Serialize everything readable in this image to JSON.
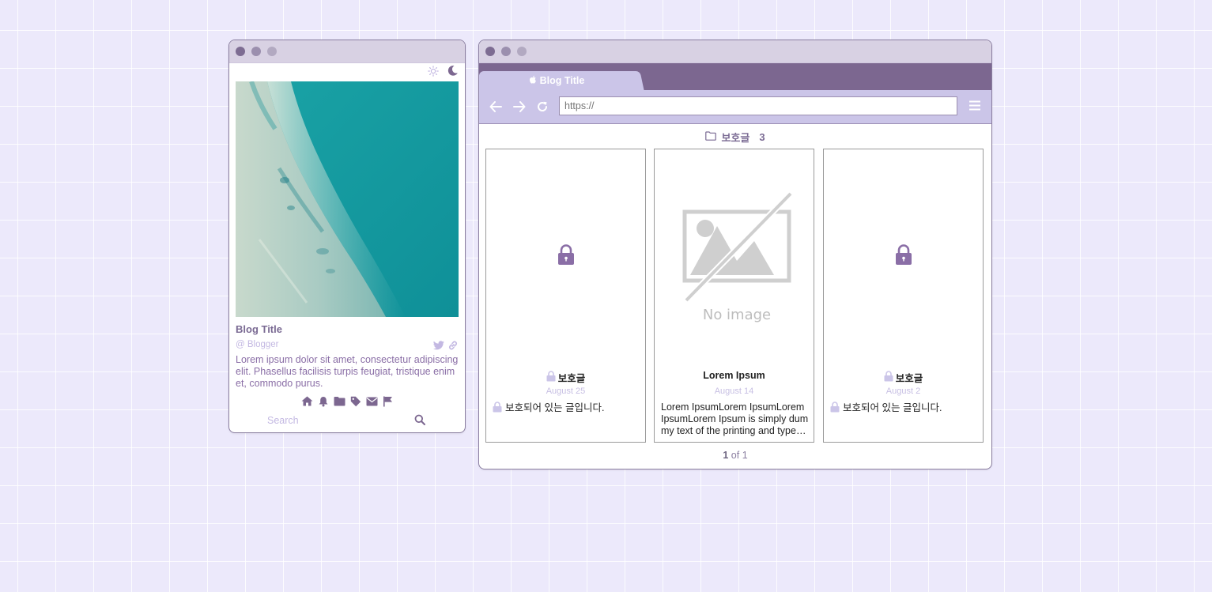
{
  "left_window": {
    "theme": {
      "light_icon": "sun-icon",
      "dark_icon": "moon-icon"
    },
    "hero_image": "ocean-shore-photo",
    "blog_title": "Blog Title",
    "handle": "@ Blogger",
    "social_icons": [
      "twitter-icon",
      "link-icon"
    ],
    "description": "Lorem ipsum dolor sit amet, consectetur adipiscing elit. Phasellus facilisis turpis feugiat, tristique enim et, commodo purus.",
    "nav_icons": [
      "home-icon",
      "bell-icon",
      "folder-icon",
      "tag-icon",
      "mail-icon",
      "flag-icon"
    ],
    "search": {
      "placeholder": "Search",
      "value": ""
    }
  },
  "browser": {
    "tab": {
      "icon": "apple-icon",
      "label": "Blog Title"
    },
    "url": {
      "placeholder": "https://",
      "value": ""
    },
    "folder": {
      "icon": "folder-icon",
      "label": "보호글",
      "count": "3"
    },
    "cards": [
      {
        "type": "locked",
        "title": "보호글",
        "date": "August 25",
        "excerpt": "보호되어 있는 글입니다."
      },
      {
        "type": "no-image",
        "thumb_text": "No image",
        "title": "Lorem Ipsum",
        "date": "August 14",
        "excerpt": "Lorem IpsumLorem IpsumLorem IpsumLorem Ipsum is simply dummy text of the printing and typesetting industry."
      },
      {
        "type": "locked",
        "title": "보호글",
        "date": "August 2",
        "excerpt": "보호되어 있는 글입니다."
      }
    ],
    "pagination": {
      "current": "1",
      "separator": "of",
      "total": "1"
    }
  },
  "colors": {
    "background": "#ece9fb",
    "accent": "#7c6790",
    "toolbar": "#cbc5e8",
    "muted_lavender": "#c3b8e2",
    "lock_purple": "#8a6ea6"
  }
}
